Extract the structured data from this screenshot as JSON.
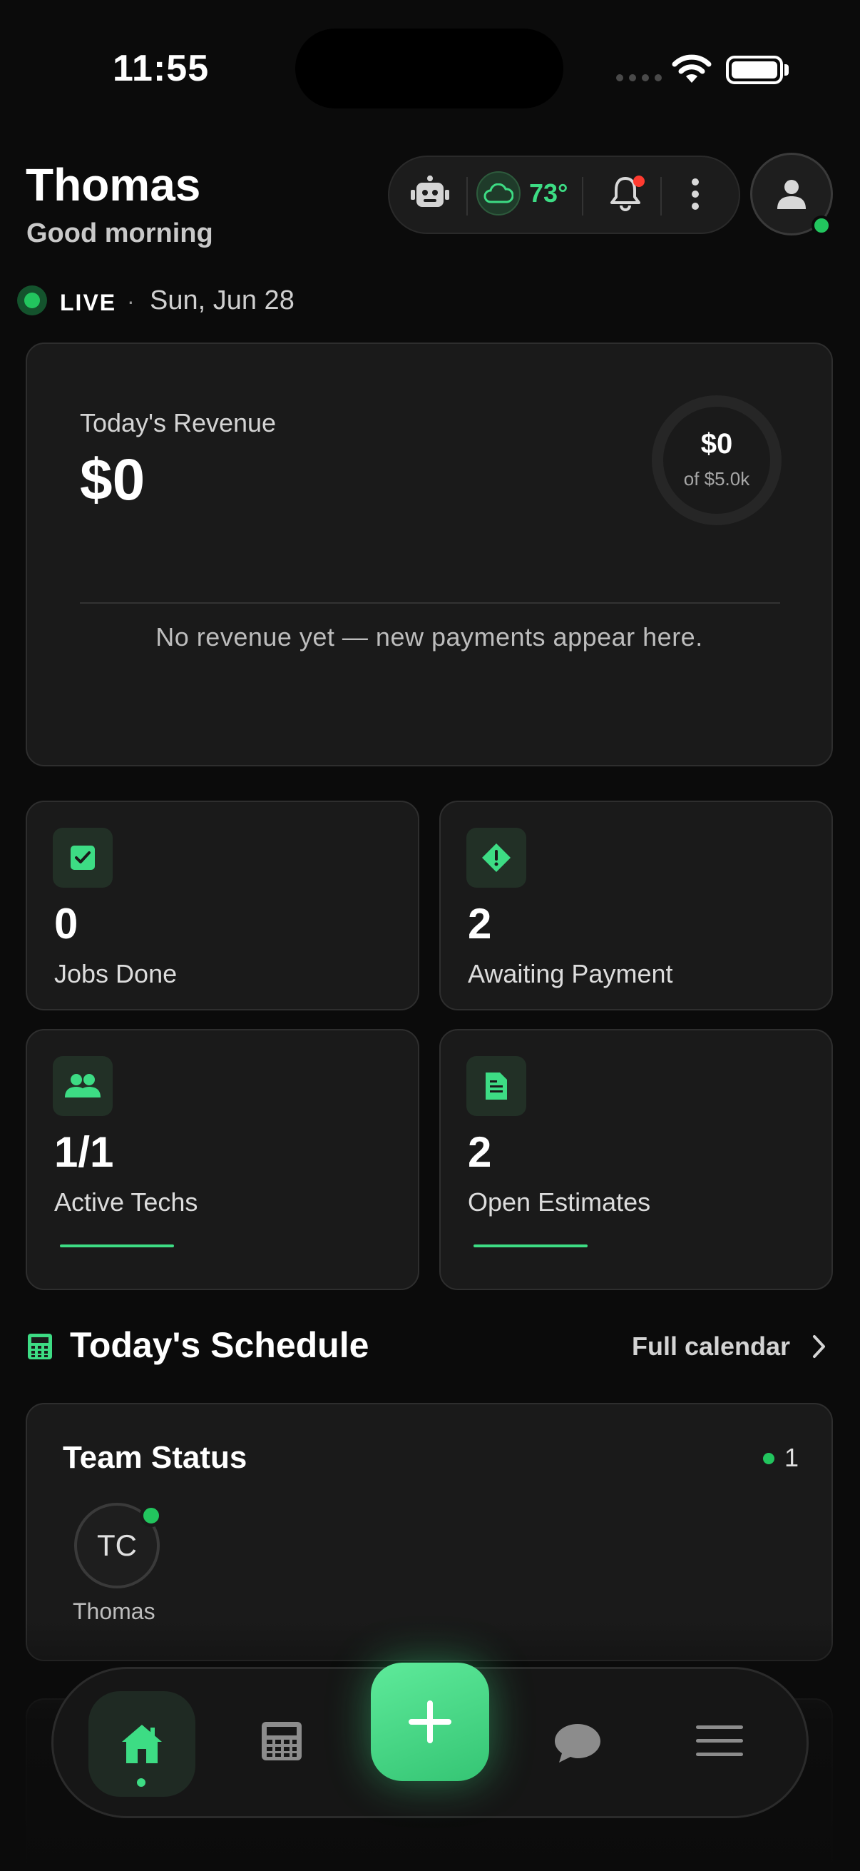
{
  "status_bar": {
    "time": "11:55"
  },
  "header": {
    "user_name": "Thomas",
    "greeting": "Good morning",
    "temperature": "73°",
    "notification_badge_color": "#ff3b30"
  },
  "live": {
    "label": "LIVE",
    "separator": "·",
    "date": "Sun, Jun 28"
  },
  "revenue": {
    "label": "Today's Revenue",
    "value": "$0",
    "goal_value": "$0",
    "goal_caption": "of $5.0k",
    "goal_progress": 0,
    "empty_message": "No revenue yet — new payments appear here."
  },
  "stats": [
    {
      "icon": "check-square-icon",
      "value": "0",
      "label": "Jobs Done"
    },
    {
      "icon": "alert-diamond-icon",
      "value": "2",
      "label": "Awaiting Payment"
    },
    {
      "icon": "users-icon",
      "value": "1/1",
      "label": "Active Techs"
    },
    {
      "icon": "document-icon",
      "value": "2",
      "label": "Open Estimates"
    }
  ],
  "schedule": {
    "title": "Today's Schedule",
    "full_calendar_label": "Full calendar"
  },
  "team_status": {
    "title": "Team Status",
    "online_count": "1",
    "members": [
      {
        "initials": "TC",
        "name": "Thomas",
        "online": true
      }
    ]
  },
  "bottom_nav": {
    "items": [
      "home-icon",
      "calculator-icon",
      "plus-icon",
      "chat-icon",
      "menu-icon"
    ],
    "active": "home-icon"
  },
  "colors": {
    "accent": "#3ddc84",
    "online": "#22c55e",
    "background": "#0b0b0b",
    "card": "#1a1a1a"
  }
}
